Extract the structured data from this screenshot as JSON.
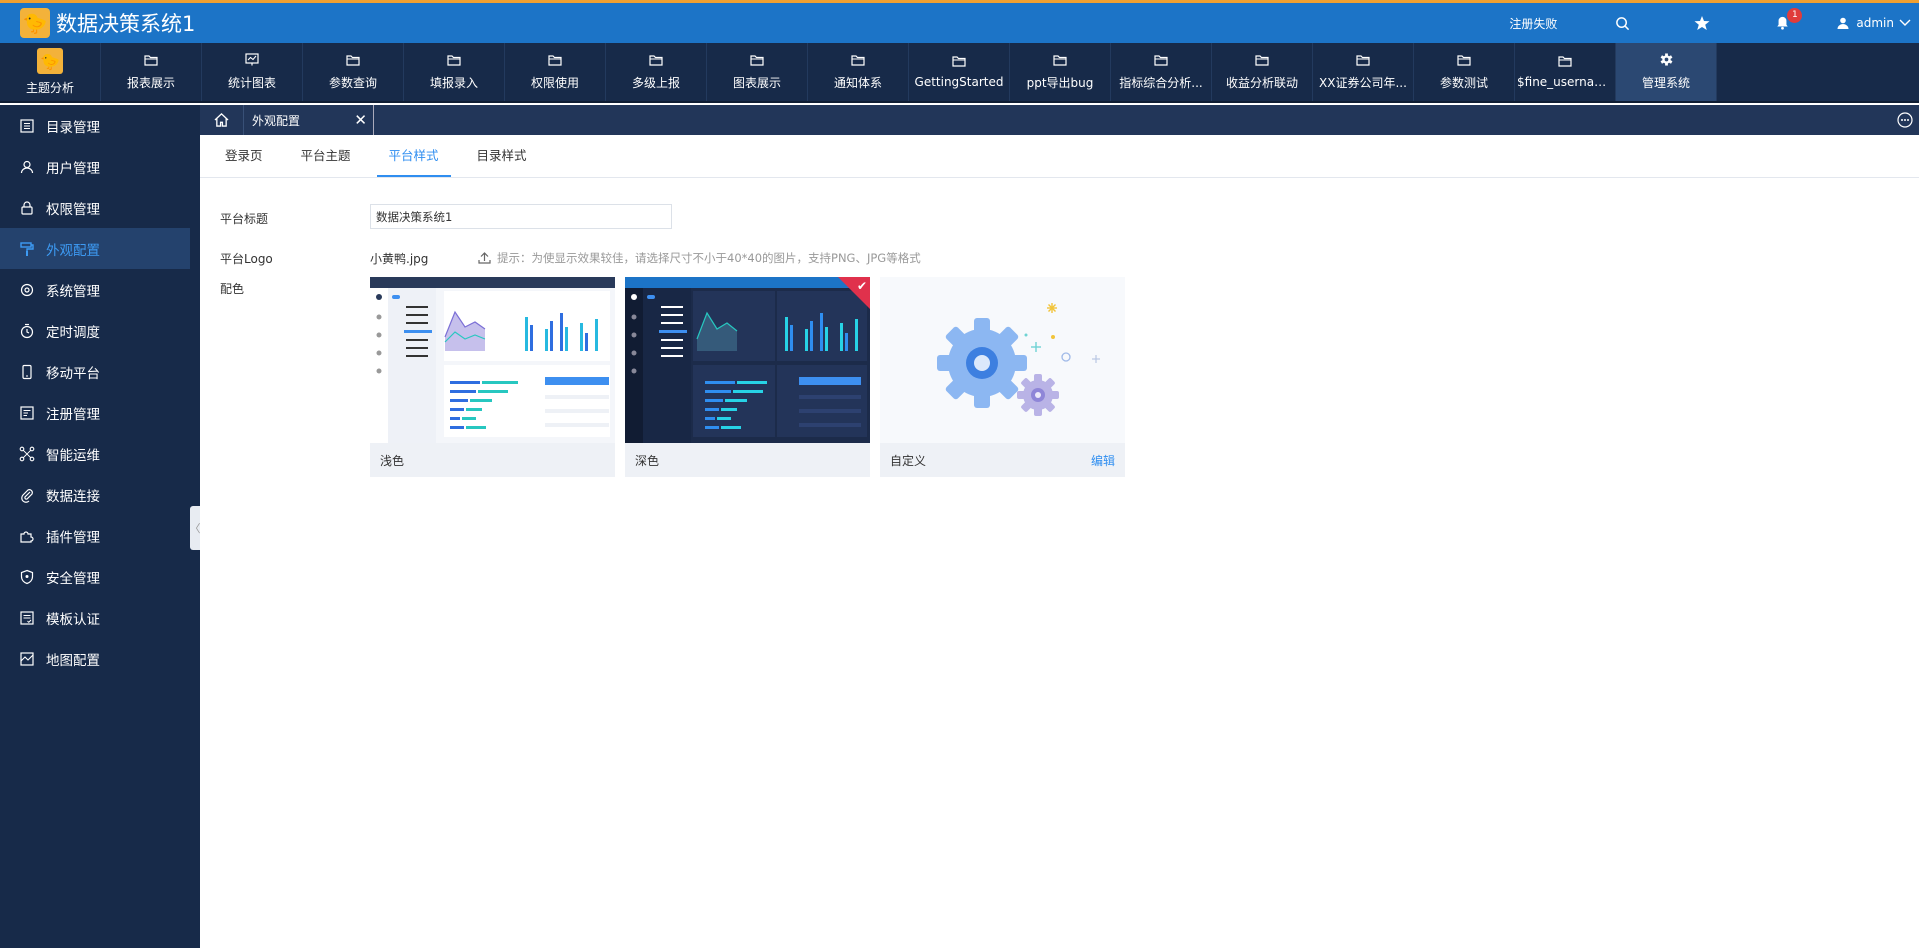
{
  "app": {
    "title": "数据决策系统1"
  },
  "header": {
    "register_status": "注册失败",
    "notification_count": "1",
    "user_name": "admin"
  },
  "nav": {
    "items": [
      {
        "label": "主题分析",
        "icon": "avatar-icon"
      },
      {
        "label": "报表展示",
        "icon": "folder-icon"
      },
      {
        "label": "统计图表",
        "icon": "chart-icon"
      },
      {
        "label": "参数查询",
        "icon": "folder-icon"
      },
      {
        "label": "填报录入",
        "icon": "folder-icon"
      },
      {
        "label": "权限使用",
        "icon": "folder-icon"
      },
      {
        "label": "多级上报",
        "icon": "folder-icon"
      },
      {
        "label": "图表展示",
        "icon": "folder-icon"
      },
      {
        "label": "通知体系",
        "icon": "folder-icon"
      },
      {
        "label": "GettingStarted",
        "icon": "folder-icon"
      },
      {
        "label": "ppt导出bug",
        "icon": "folder-icon"
      },
      {
        "label": "指标综合分析...",
        "icon": "folder-icon"
      },
      {
        "label": "收益分析联动",
        "icon": "folder-icon"
      },
      {
        "label": "XX证券公司年...",
        "icon": "folder-icon"
      },
      {
        "label": "参数测试",
        "icon": "folder-icon"
      },
      {
        "label": "$fine_usernam...",
        "icon": "folder-icon"
      },
      {
        "label": "管理系统",
        "icon": "gear-icon"
      }
    ]
  },
  "sidebar": {
    "items": [
      {
        "label": "目录管理"
      },
      {
        "label": "用户管理"
      },
      {
        "label": "权限管理"
      },
      {
        "label": "外观配置"
      },
      {
        "label": "系统管理"
      },
      {
        "label": "定时调度"
      },
      {
        "label": "移动平台"
      },
      {
        "label": "注册管理"
      },
      {
        "label": "智能运维"
      },
      {
        "label": "数据连接"
      },
      {
        "label": "插件管理"
      },
      {
        "label": "安全管理"
      },
      {
        "label": "模板认证"
      },
      {
        "label": "地图配置"
      }
    ]
  },
  "tabs": {
    "open_tab_label": "外观配置"
  },
  "subtabs": {
    "items": [
      "登录页",
      "平台主题",
      "平台样式",
      "目录样式"
    ]
  },
  "form": {
    "title_label": "平台标题",
    "title_value": "数据决策系统1",
    "logo_label": "平台Logo",
    "logo_file": "小黄鸭.jpg",
    "upload_hint": "提示：为使显示效果较佳，请选择尺寸不小于40*40的图片，支持PNG、JPG等格式",
    "color_label": "配色",
    "schemes": [
      {
        "label": "浅色",
        "selected": false
      },
      {
        "label": "深色",
        "selected": true
      },
      {
        "label": "自定义",
        "selected": false,
        "action": "编辑"
      }
    ]
  },
  "colors": {
    "primary": "#1c74c7",
    "nav_bg": "#172a49",
    "accent": "#2f8ef0",
    "selected_corner": "#e0314c"
  }
}
